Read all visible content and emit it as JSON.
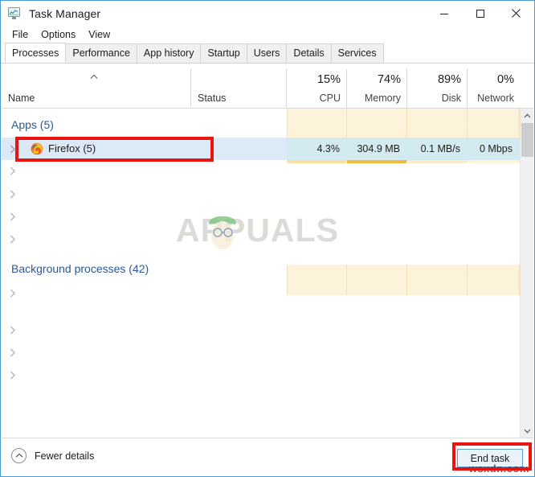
{
  "window": {
    "title": "Task Manager",
    "icon": "task-manager-icon",
    "controls": {
      "minimize": "minimize-icon",
      "maximize": "maximize-icon",
      "close": "close-icon"
    }
  },
  "menu": {
    "items": [
      "File",
      "Options",
      "View"
    ]
  },
  "tabs": {
    "items": [
      "Processes",
      "Performance",
      "App history",
      "Startup",
      "Users",
      "Details",
      "Services"
    ],
    "active": "Processes"
  },
  "columns": [
    {
      "key": "name",
      "label": "Name",
      "percent": ""
    },
    {
      "key": "status",
      "label": "Status",
      "percent": ""
    },
    {
      "key": "cpu",
      "label": "CPU",
      "percent": "15%"
    },
    {
      "key": "memory",
      "label": "Memory",
      "percent": "74%"
    },
    {
      "key": "disk",
      "label": "Disk",
      "percent": "89%"
    },
    {
      "key": "network",
      "label": "Network",
      "percent": "0%"
    }
  ],
  "groups": {
    "apps": {
      "label": "Apps (5)"
    },
    "background": {
      "label": "Background processes (42)"
    }
  },
  "selected_row": {
    "name": "Firefox (5)",
    "icon": "firefox-icon",
    "status": "",
    "cpu": "4.3%",
    "memory": "304.9 MB",
    "disk": "0.1 MB/s",
    "network": "0 Mbps"
  },
  "footer": {
    "fewer_details": "Fewer details",
    "fewer_details_icon": "chevron-up-circle-icon",
    "end_task": "End task"
  },
  "watermark": {
    "brand": "APPUALS",
    "site": "wsxdn.com"
  },
  "annotations": {
    "firefox_highlight": "red-box-firefox-row",
    "end_task_highlight": "red-box-end-task"
  },
  "colors": {
    "accent_blue": "#2b579a",
    "selection": "#dceaf7",
    "column_band": "#fdf3da",
    "heat_bar": "#f2ba3c",
    "annotation_red": "#e8140f",
    "button_border": "#5a9fd4"
  }
}
